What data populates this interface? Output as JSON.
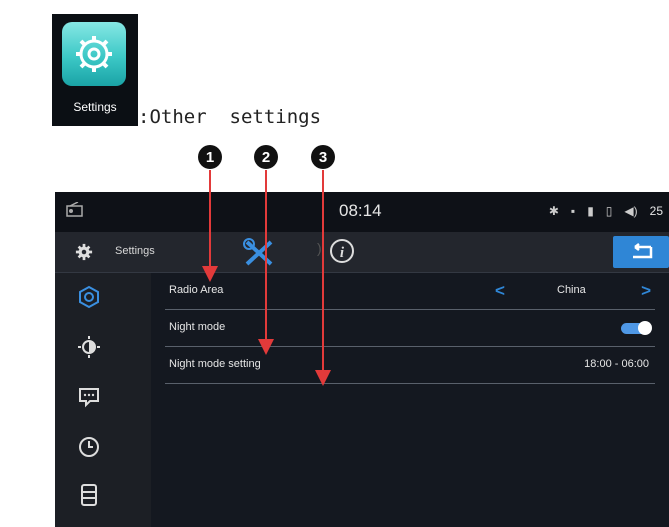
{
  "app_icon": {
    "caption": "Settings",
    "icon": "gear-icon"
  },
  "caption_prefix": ":",
  "caption_text": "Other  settings",
  "callouts": [
    "1",
    "2",
    "3"
  ],
  "status": {
    "clock": "08:14",
    "volume": "25"
  },
  "header": {
    "title": "Settings",
    "icons": [
      "tools-icon",
      "info-icon",
      "back-icon"
    ]
  },
  "sidebar": {
    "items": [
      "radio-settings-icon",
      "brightness-icon",
      "message-icon",
      "clock-icon",
      "storage-icon"
    ]
  },
  "rows": [
    {
      "label": "Radio Area",
      "value": "China"
    },
    {
      "label": "Night mode",
      "value": "on"
    },
    {
      "label": "Night mode setting",
      "value": "18:00 - 06:00"
    }
  ],
  "colors": {
    "accent": "#2f86d6",
    "pointer": "#e23a3a",
    "screen_bg": "#141820"
  }
}
